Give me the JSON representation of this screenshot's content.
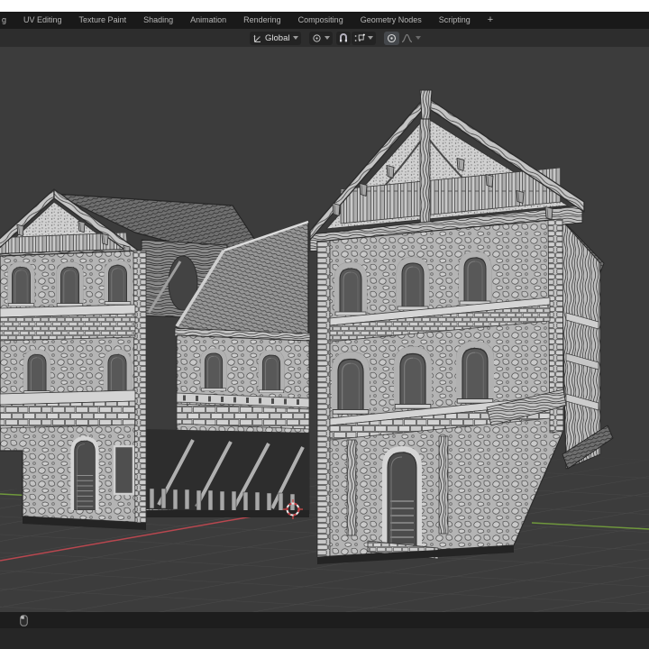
{
  "topbar": {
    "partial_tab_label": "g",
    "tabs": [
      "UV Editing",
      "Texture Paint",
      "Shading",
      "Animation",
      "Rendering",
      "Compositing",
      "Geometry Nodes",
      "Scripting"
    ],
    "new_workspace_label": "+"
  },
  "viewport_header": {
    "transform_orientation_label": "Global",
    "icons": {
      "orientation_icon": "axes-gizmo",
      "pivot_icon": "pivot-point-circle-dot",
      "snap_icon": "magnet",
      "snap_with_icon": "snap-increment-dots",
      "proportional_icon": "circle-dot",
      "falloff_icon": "smooth-falloff-curve",
      "chevron": "v"
    }
  },
  "viewport": {
    "scene_object": "medieval-stone-building-mesh",
    "colors": {
      "background": "#3c3c3c",
      "grid_line": "#4a4a4a",
      "x_axis": "#b8474f",
      "y_axis": "#70993c",
      "cursor_red": "#c23a40",
      "cursor_white": "#ececec",
      "mesh_light": "#c8c8c8",
      "mesh_dark": "#3a3a3a"
    }
  },
  "status_bar": {
    "mouse_icon": "mouse"
  }
}
